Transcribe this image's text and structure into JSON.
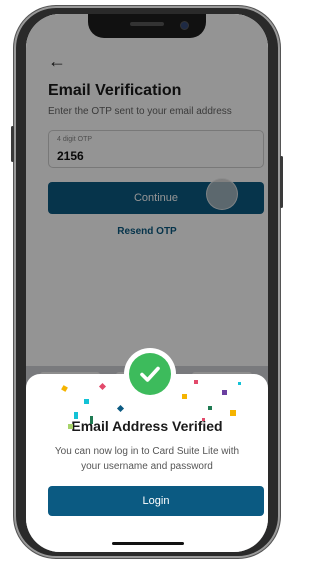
{
  "screen": {
    "back_icon": "arrow-left-icon",
    "title": "Email Verification",
    "subtitle": "Enter the OTP sent to your email address",
    "otp_field": {
      "label": "4 digit OTP",
      "value": "2156"
    },
    "continue_label": "Continue",
    "resend_label": "Resend OTP"
  },
  "modal": {
    "icon": "checkmark-icon",
    "title": "Email Address Verified",
    "message": "You can now log in to Card Suite Lite with your username and password",
    "login_label": "Login"
  },
  "colors": {
    "primary": "#0b5a82",
    "success": "#3dbb5c",
    "overlay": "rgba(0,0,0,0.42)"
  }
}
